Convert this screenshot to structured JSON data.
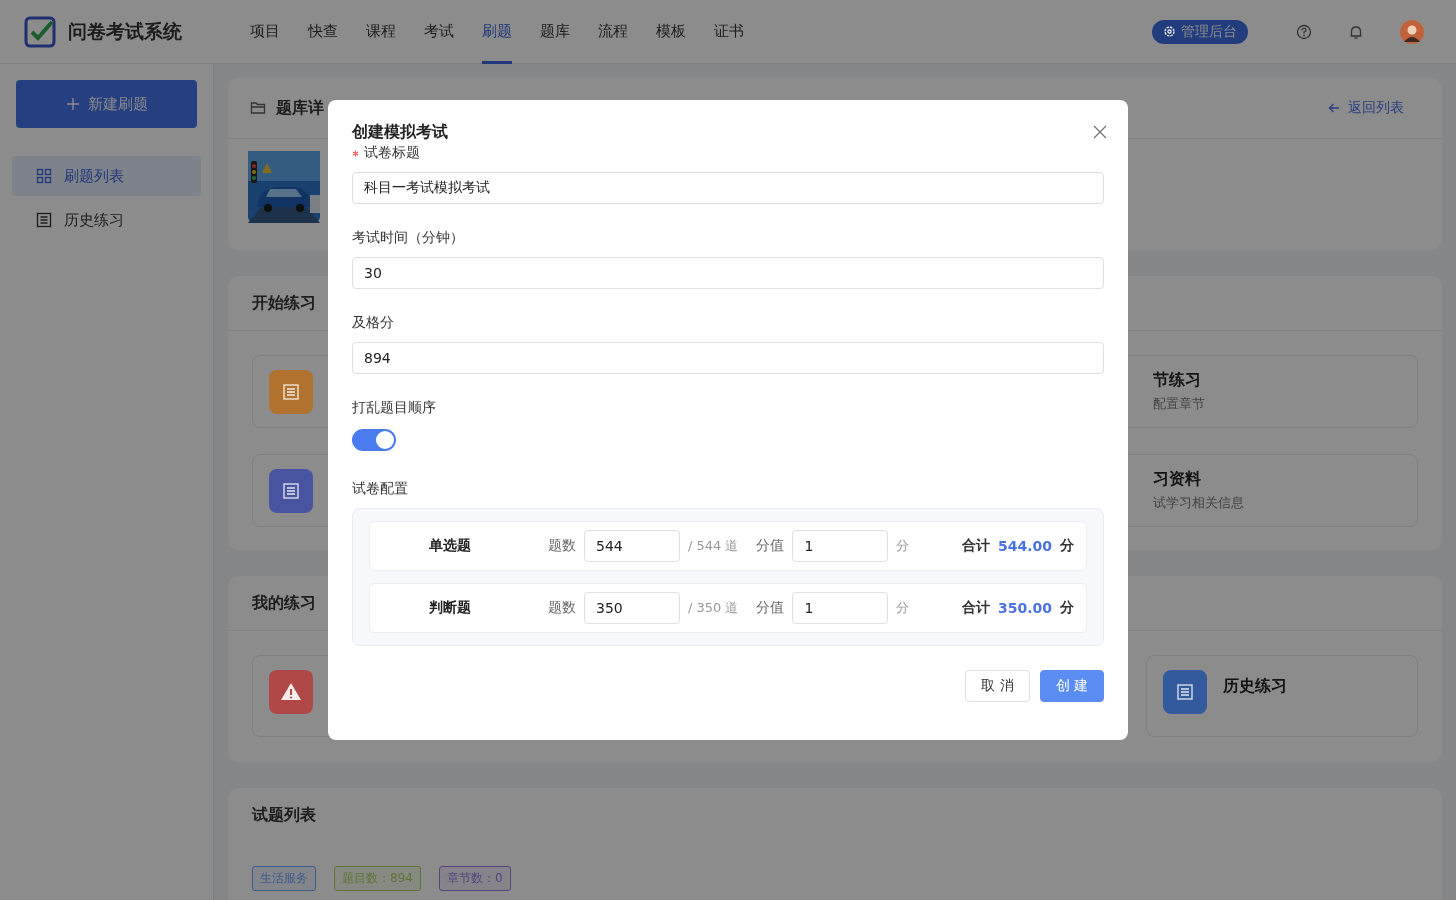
{
  "header": {
    "app_title": "问卷考试系统",
    "admin_button": "管理后台",
    "nav": [
      {
        "label": "项目",
        "selected": false
      },
      {
        "label": "快查",
        "selected": false
      },
      {
        "label": "课程",
        "selected": false
      },
      {
        "label": "考试",
        "selected": false
      },
      {
        "label": "刷题",
        "selected": true
      },
      {
        "label": "题库",
        "selected": false
      },
      {
        "label": "流程",
        "selected": false
      },
      {
        "label": "模板",
        "selected": false
      },
      {
        "label": "证书",
        "selected": false
      }
    ]
  },
  "sidebar": {
    "new_button": "新建刷题",
    "items": [
      {
        "label": "刷题列表",
        "selected": true,
        "kind": "grid"
      },
      {
        "label": "历史练习",
        "selected": false,
        "kind": "list"
      }
    ]
  },
  "bank_card": {
    "title": "题库详",
    "back_link": "返回列表"
  },
  "start_section": {
    "title": "开始练习",
    "left_cards": [
      {
        "color": "#b0722e"
      },
      {
        "color": "#4854a0"
      }
    ],
    "right_cards": [
      {
        "title": "节练习",
        "subtitle": "配置章节"
      },
      {
        "title": "习资料",
        "subtitle": "试学习相关信息"
      }
    ]
  },
  "my_section": {
    "title": "我的练习",
    "cards": [
      {
        "kind": "warning",
        "color": "#b04848"
      },
      {
        "kind": "history",
        "color": "#335a9c",
        "title": "历史练习"
      }
    ]
  },
  "question_list": {
    "title": "试题列表",
    "tags": [
      {
        "label": "生活服务",
        "color": "#3f5a8c"
      },
      {
        "label": "题目数：894",
        "color": "#5f7438"
      },
      {
        "label": "章节数：0",
        "color": "#56437e"
      }
    ]
  },
  "dialog": {
    "title": "创建模拟考试",
    "fields": [
      {
        "label": "试卷标题",
        "required": true,
        "value": "科目一考试模拟考试"
      },
      {
        "label": "考试时间（分钟）",
        "required": false,
        "value": "30"
      },
      {
        "label": "及格分",
        "required": false,
        "value": "894"
      }
    ],
    "shuffle": {
      "label": "打乱题目顺序",
      "on": true
    },
    "config": {
      "label": "试卷配置",
      "rows": [
        {
          "type": "单选题",
          "count_label": "题数",
          "count": "544",
          "total": "/ 544 道",
          "score_label": "分值",
          "score": "1",
          "unit": "分",
          "sum_label": "合计",
          "sum": "544.00",
          "sum_unit": "分"
        },
        {
          "type": "判断题",
          "count_label": "题数",
          "count": "350",
          "total": "/ 350 道",
          "score_label": "分值",
          "score": "1",
          "unit": "分",
          "sum_label": "合计",
          "sum": "350.00",
          "sum_unit": "分"
        }
      ]
    },
    "cancel_button": "取 消",
    "create_button": "创 建"
  }
}
